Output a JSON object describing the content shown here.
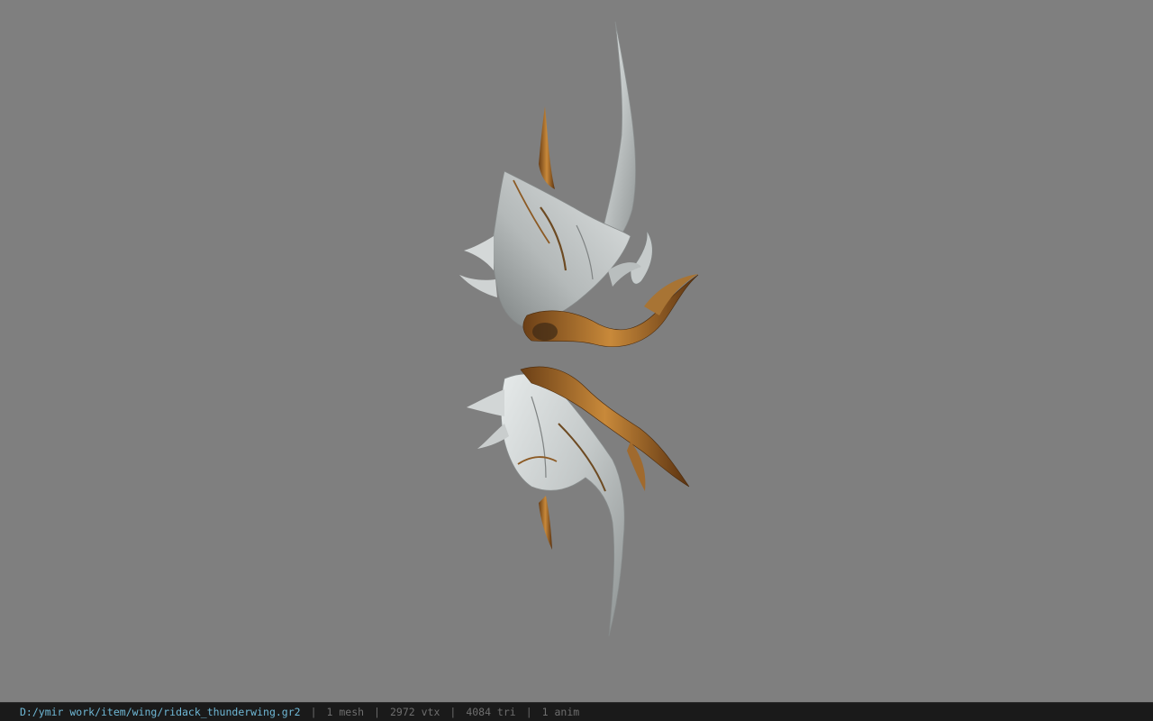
{
  "viewer": {
    "background_color": "#7f7f7f",
    "model_name": "ridack_thunderwing"
  },
  "status_bar": {
    "file_path": "D:/ymir work/item/wing/ridack_thunderwing.gr2",
    "separator": "|",
    "mesh_count": "1 mesh",
    "vertex_count": "2972 vtx",
    "triangle_count": "4084 tri",
    "anim_count": "1 anim",
    "path_color": "#6fb8d6",
    "background_color": "#1a1a1a"
  }
}
